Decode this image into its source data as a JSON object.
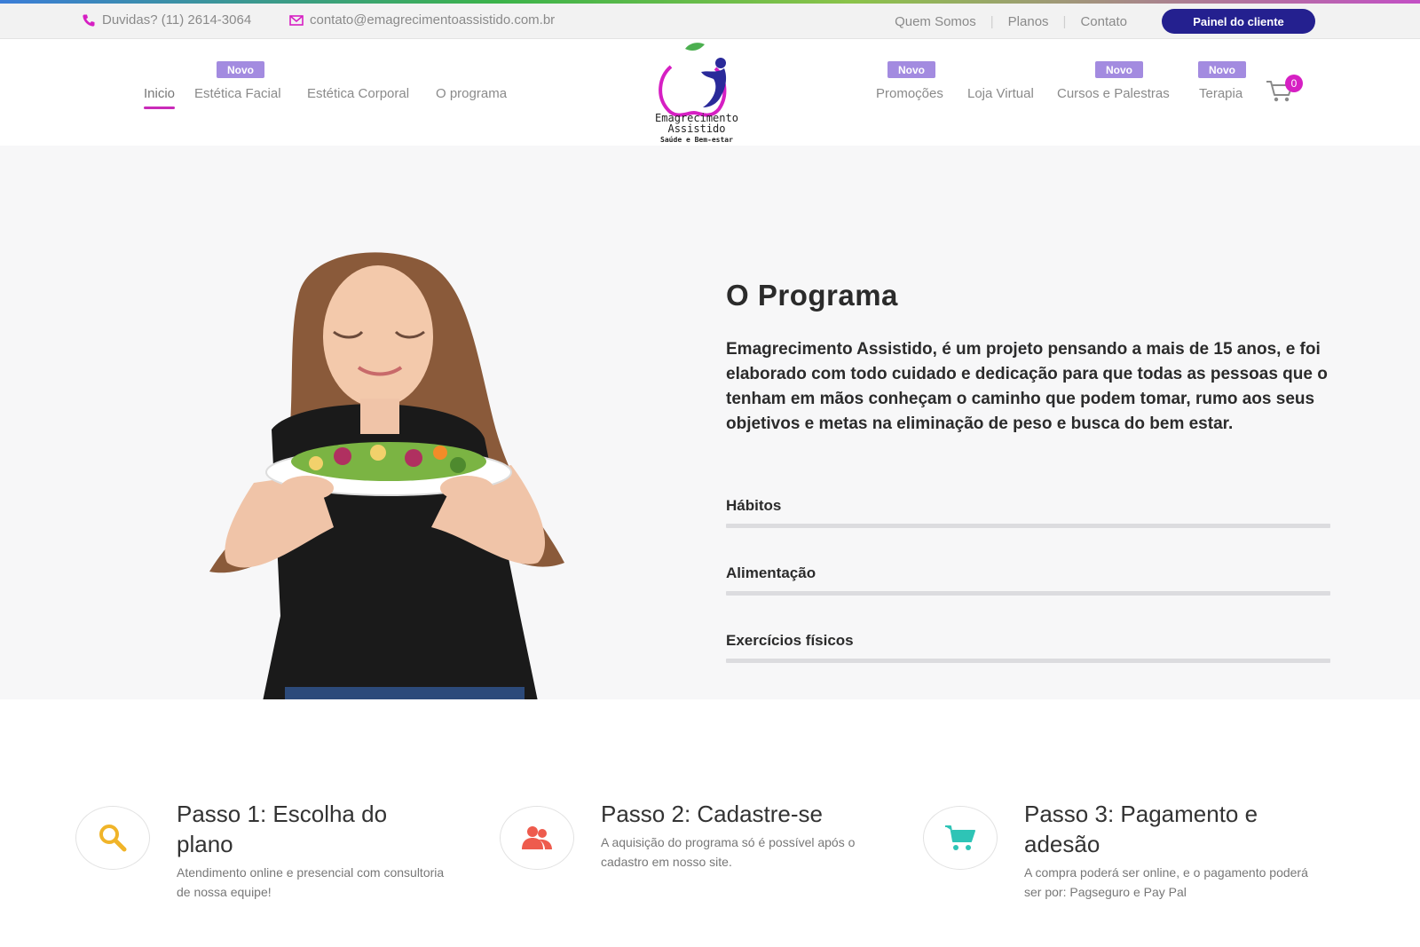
{
  "topbar": {
    "phone": "Duvidas? (11) 2614-3064",
    "email": "contato@emagrecimentoassistido.com.br",
    "links": [
      "Quem Somos",
      "Planos",
      "Contato"
    ],
    "client_button": "Painel do cliente"
  },
  "nav": {
    "left": [
      {
        "label": "Inicio",
        "badge": ""
      },
      {
        "label": "Estética Facial",
        "badge": "Novo"
      },
      {
        "label": "Estética Corporal",
        "badge": ""
      },
      {
        "label": "O programa",
        "badge": ""
      }
    ],
    "right": [
      {
        "label": "Promoções",
        "badge": "Novo"
      },
      {
        "label": "Loja Virtual",
        "badge": ""
      },
      {
        "label": "Cursos e Palestras",
        "badge": "Novo"
      },
      {
        "label": "Terapia",
        "badge": "Novo"
      }
    ],
    "cart_count": "0"
  },
  "logo": {
    "line1": "Emagrecimento",
    "line2": "Assistido",
    "tagline": "Saúde e Bem-estar"
  },
  "hero": {
    "title": "O Programa",
    "text": "Emagrecimento Assistido, é um projeto pensando a mais de 15 anos, e foi elaborado com todo cuidado e dedicação para que todas as pessoas que o tenham em mãos conheçam o caminho que podem tomar, rumo aos seus objetivos e metas na eliminação de peso e busca do bem estar.",
    "accordion": [
      "Hábitos",
      "Alimentação",
      "Exercícios físicos"
    ]
  },
  "steps": [
    {
      "title": "Passo 1: Escolha do plano",
      "desc": "Atendimento online e presencial com consultoria de nossa equipe!",
      "icon": "search-icon"
    },
    {
      "title": "Passo 2: Cadastre-se",
      "desc": "A aquisição do programa só é possível após o cadastro em nosso site.",
      "icon": "users-icon"
    },
    {
      "title": "Passo 3: Pagamento e adesão",
      "desc": "A compra poderá ser online, e o pagamento poderá ser por: Pagseguro e Pay Pal",
      "icon": "cart-icon"
    }
  ],
  "colors": {
    "accent": "#c92ab8",
    "badge": "#a38be0",
    "client_button": "#24208f",
    "step1_icon": "#f0b429",
    "step2_icon": "#ee5b4d",
    "step3_icon": "#2ec4b6"
  }
}
